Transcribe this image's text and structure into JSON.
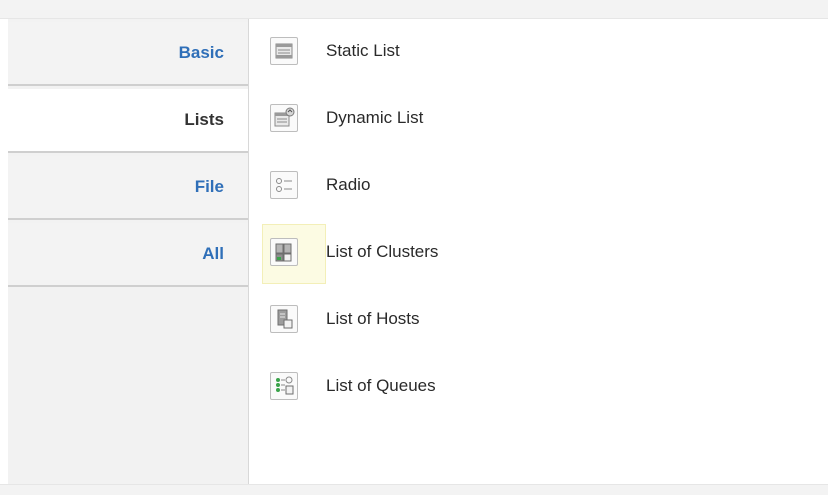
{
  "nav": {
    "tabs": [
      {
        "label": "Basic",
        "active": false
      },
      {
        "label": "Lists",
        "active": true
      },
      {
        "label": "File",
        "active": false
      },
      {
        "label": "All",
        "active": false
      }
    ]
  },
  "list": {
    "items": [
      {
        "label": "Static List",
        "icon": "static-list-icon"
      },
      {
        "label": "Dynamic List",
        "icon": "dynamic-list-icon"
      },
      {
        "label": "Radio",
        "icon": "radio-icon"
      },
      {
        "label": "List of Clusters",
        "icon": "clusters-icon",
        "highlighted": true
      },
      {
        "label": "List of Hosts",
        "icon": "hosts-icon"
      },
      {
        "label": "List of Queues",
        "icon": "queues-icon"
      }
    ]
  },
  "colors": {
    "link_blue": "#2f6fb8",
    "highlight_yellow": "#fcfbe3",
    "nav_bg": "#f3f3f3"
  }
}
